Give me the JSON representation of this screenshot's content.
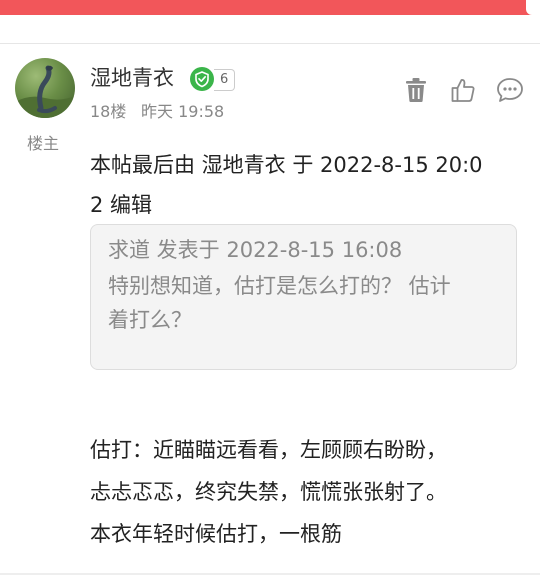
{
  "post": {
    "username": "湿地青衣",
    "level": "6",
    "floor": "18楼",
    "time": "昨天 19:58",
    "role": "楼主",
    "edit_note_line1": "本帖最后由 湿地青衣 于 2022-8-15 20:0",
    "edit_note_line2": "2 编辑",
    "quote": {
      "author_line": "求道 发表于 2022-8-15 16:08",
      "text_line1": "特别想知道，估打是怎么打的？ 估计",
      "text_line2": "着打么？"
    },
    "content_lines": [
      "估打：近瞄瞄远看看，左顾顾右盼盼，",
      "忐忐忑忑，终究失禁，慌慌张张射了。",
      "本衣年轻时候估打，一根筋"
    ]
  },
  "icons": {
    "trash": "trash-icon",
    "like": "thumbs-up-icon",
    "comment": "comment-icon",
    "verified": "shield-check-icon"
  },
  "colors": {
    "topbar": "#f2565a",
    "badge_green": "#3bb54a",
    "icon_gray": "#8a8a8a"
  }
}
